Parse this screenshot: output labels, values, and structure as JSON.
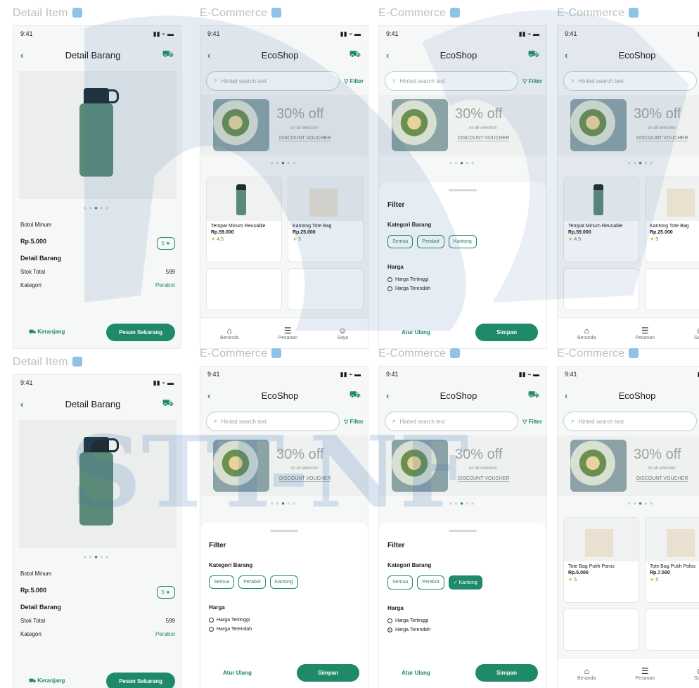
{
  "frames": [
    {
      "title": "Detail Item",
      "type": "detail",
      "pos": "r1c1"
    },
    {
      "title": "E-Commerce",
      "type": "list",
      "pos": "r1c2"
    },
    {
      "title": "E-Commerce",
      "type": "filter",
      "pos": "r1c3"
    },
    {
      "title": "E-Commerce",
      "type": "list",
      "pos": "r1c4"
    },
    {
      "title": "Detail Item",
      "type": "detail",
      "pos": "r2c1"
    },
    {
      "title": "E-Commerce",
      "type": "filter",
      "pos": "r2c2"
    },
    {
      "title": "E-Commerce",
      "type": "filter2",
      "pos": "r2c3"
    },
    {
      "title": "E-Commerce",
      "type": "list2",
      "pos": "r2c4"
    }
  ],
  "status": {
    "time": "9:41",
    "icons": "▮▮ ⌁ ▬"
  },
  "detail": {
    "appbar_title": "Detail Barang",
    "product_name": "Botol Minum",
    "price": "Rp.5.000",
    "rating": "5 ★",
    "section": "Detail Barang",
    "stok_label": "Stok Total",
    "stok_value": "599",
    "kategori_label": "Kategori",
    "kategori_value": "Perabot",
    "btn_cart": "Keranjang",
    "btn_order": "Pesan Sekarang"
  },
  "list": {
    "appbar_title": "EcoShop",
    "search_placeholder": "Hinted search text",
    "filter": "Filter",
    "banner_pct": "30% off",
    "banner_sub": "on all selection",
    "banner_voucher": "DISCOUNT VOUCHER",
    "products": [
      {
        "title": "Tempat Minum Reusable",
        "price": "Rp.59.000",
        "rating": "4.5"
      },
      {
        "title": "Kantong Tote Bag",
        "price": "Rp.25.000",
        "rating": "5"
      }
    ],
    "products2": [
      {
        "title": "Tote Bag Putih Paros",
        "price": "Rp.5.000",
        "rating": "5"
      },
      {
        "title": "Tote Bag Putih Polos",
        "price": "Rp.7.500",
        "rating": "5"
      }
    ],
    "nav": [
      {
        "label": "Beranda",
        "icon": "⌂"
      },
      {
        "label": "Pesanan",
        "icon": "☰"
      },
      {
        "label": "Saya",
        "icon": "☺"
      }
    ]
  },
  "filter": {
    "title": "Filter",
    "kategori": "Kategori Barang",
    "chips": [
      "Semua",
      "Perabot",
      "Kantong"
    ],
    "harga": "Harga",
    "radio": [
      "Harga Tertinggi",
      "Harga Terendah"
    ],
    "reset": "Atur Ulang",
    "save": "Simpan"
  }
}
